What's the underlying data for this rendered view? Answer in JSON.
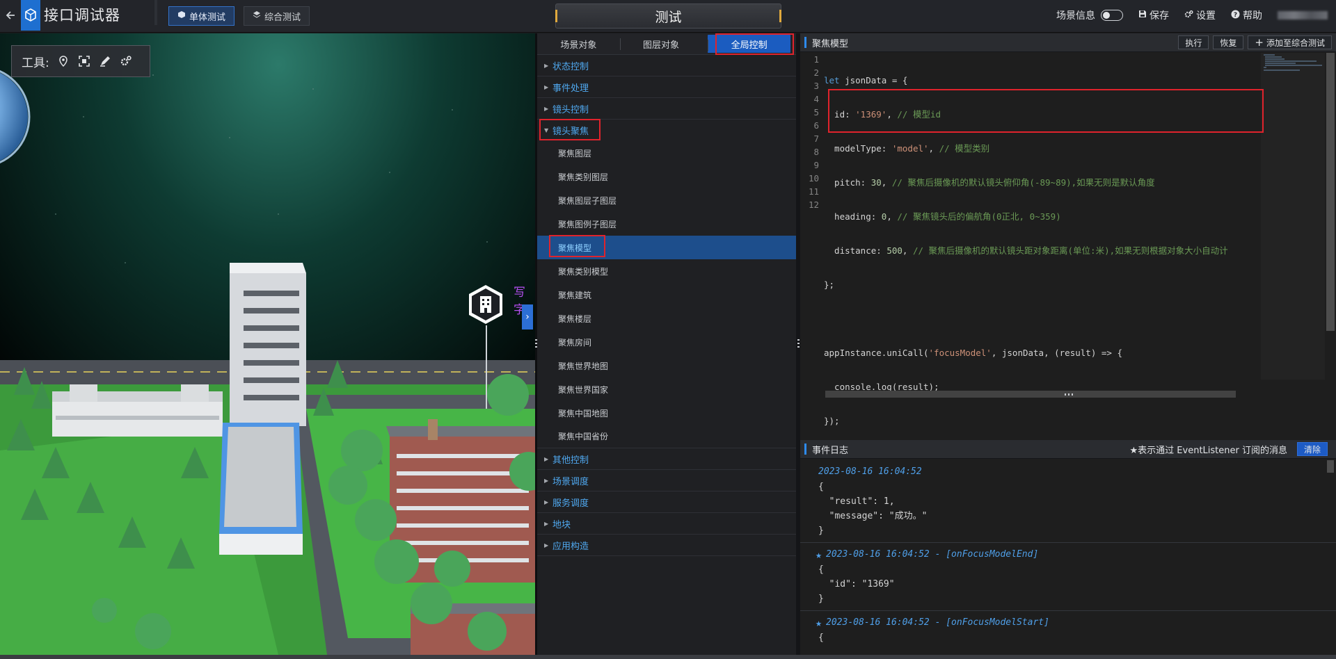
{
  "header": {
    "title": "接口调试器",
    "modes": [
      {
        "label": "单体测试",
        "active": true
      },
      {
        "label": "综合测试",
        "active": false
      }
    ],
    "center_tab": "测试",
    "right": {
      "scene_info": "场景信息",
      "save": "保存",
      "settings": "设置",
      "help": "帮助"
    }
  },
  "scene": {
    "toolbox_label": "工具:",
    "tools": [
      "locate-icon",
      "frame-icon",
      "pen-icon",
      "gears-icon"
    ],
    "floating_label": "写字"
  },
  "api_panel": {
    "tabs": [
      {
        "label": "场景对象",
        "active": false
      },
      {
        "label": "图层对象",
        "active": false
      },
      {
        "label": "全局控制",
        "active": true
      }
    ],
    "categories_top": [
      {
        "label": "状态控制"
      },
      {
        "label": "事件处理"
      },
      {
        "label": "镜头控制"
      }
    ],
    "expanded": {
      "label": "镜头聚焦",
      "items": [
        "聚焦图层",
        "聚焦类别图层",
        "聚焦图层子图层",
        "聚焦图例子图层",
        "聚焦模型",
        "聚焦类别模型",
        "聚焦建筑",
        "聚焦楼层",
        "聚焦房间",
        "聚焦世界地图",
        "聚焦世界国家",
        "聚焦中国地图",
        "聚焦中国省份"
      ],
      "active_item": "聚焦模型"
    },
    "categories_bottom": [
      {
        "label": "其他控制"
      },
      {
        "label": "场景调度"
      },
      {
        "label": "服务调度"
      },
      {
        "label": "地块"
      },
      {
        "label": "应用构造"
      }
    ]
  },
  "editor": {
    "title": "聚焦模型",
    "buttons": {
      "run": "执行",
      "restore": "恢复",
      "add": "添加至综合测试"
    },
    "line_numbers": [
      "1",
      "2",
      "3",
      "4",
      "5",
      "6",
      "7",
      "8",
      "9",
      "10",
      "11",
      "12"
    ],
    "code": {
      "l1_kw": "let",
      "l1_rest": " jsonData = {",
      "l2_a": "  id: ",
      "l2_s": "'1369'",
      "l2_b": ", ",
      "l2_c": "// 模型id",
      "l3_a": "  modelType: ",
      "l3_s": "'model'",
      "l3_b": ", ",
      "l3_c": "// 模型类别",
      "l4_a": "  pitch: ",
      "l4_n": "30",
      "l4_b": ", ",
      "l4_c": "// 聚焦后摄像机的默认镜头俯仰角(-89~89),如果无则是默认角度",
      "l5_a": "  heading: ",
      "l5_n": "0",
      "l5_b": ", ",
      "l5_c": "// 聚焦镜头后的偏航角(0正北, 0~359)",
      "l6_a": "  distance: ",
      "l6_n": "500",
      "l6_b": ", ",
      "l6_c": "// 聚焦后摄像机的默认镜头距对象距离(单位:米),如果无则根据对象大小自动计",
      "l7": "};",
      "l9_a": "appInstance.uniCall(",
      "l9_s": "'focusModel'",
      "l9_b": ", jsonData, (result) => {",
      "l10": "  console.log(result);",
      "l11": "});"
    }
  },
  "event_log": {
    "title": "事件日志",
    "hint": "★表示通过 EventListener 订阅的消息",
    "clear": "清除",
    "entries": [
      {
        "time": "2023-08-16 16:04:52",
        "lines": [
          "{",
          "  \"result\": 1,",
          "  \"message\": \"成功。\"",
          "}"
        ]
      },
      {
        "time": "2023-08-16 16:04:52 - [onFocusModelEnd]",
        "lines": [
          "{",
          "  \"id\": \"1369\"",
          "}"
        ]
      },
      {
        "time": "2023-08-16 16:04:52 - [onFocusModelStart]",
        "lines": [
          "{"
        ]
      }
    ]
  }
}
